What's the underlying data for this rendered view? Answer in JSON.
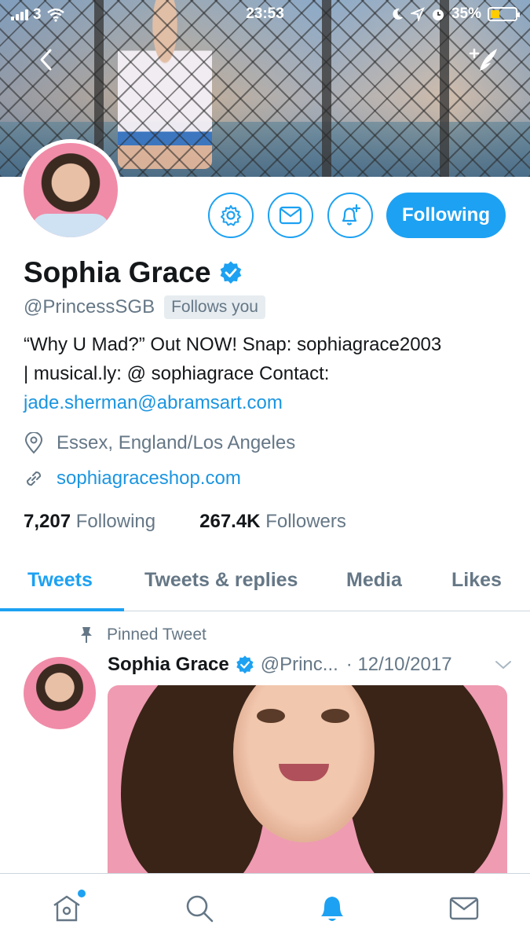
{
  "status_bar": {
    "carrier": "3",
    "time": "23:53",
    "battery": "35%",
    "battery_level": 0.35
  },
  "header": {
    "back_icon": "chevron-left-icon",
    "compose_icon": "compose-feather-icon"
  },
  "profile": {
    "name": "Sophia Grace",
    "verified": true,
    "handle": "@PrincessSGB",
    "follows_you": "Follows you",
    "bio_line1": "“Why U Mad?” Out NOW! Snap: sophiagrace2003",
    "bio_line2": "| musical.ly: @ sophiagrace Contact:",
    "bio_email": "jade.sherman@abramsart.com",
    "location": "Essex, England/Los Angeles",
    "website": "sophiagraceshop.com",
    "following_count": "7,207",
    "following_label": "Following",
    "followers_count": "267.4K",
    "followers_label": "Followers"
  },
  "actions": {
    "following_button": "Following"
  },
  "tabs": [
    {
      "label": "Tweets",
      "active": true
    },
    {
      "label": "Tweets & replies",
      "active": false
    },
    {
      "label": "Media",
      "active": false
    },
    {
      "label": "Likes",
      "active": false
    }
  ],
  "tweet": {
    "pinned_label": "Pinned Tweet",
    "name": "Sophia Grace",
    "handle": "@Princ...",
    "date": "· 12/10/2017"
  },
  "colors": {
    "accent": "#1da1f2",
    "link": "#1b95e0",
    "secondary_text": "#657786"
  }
}
